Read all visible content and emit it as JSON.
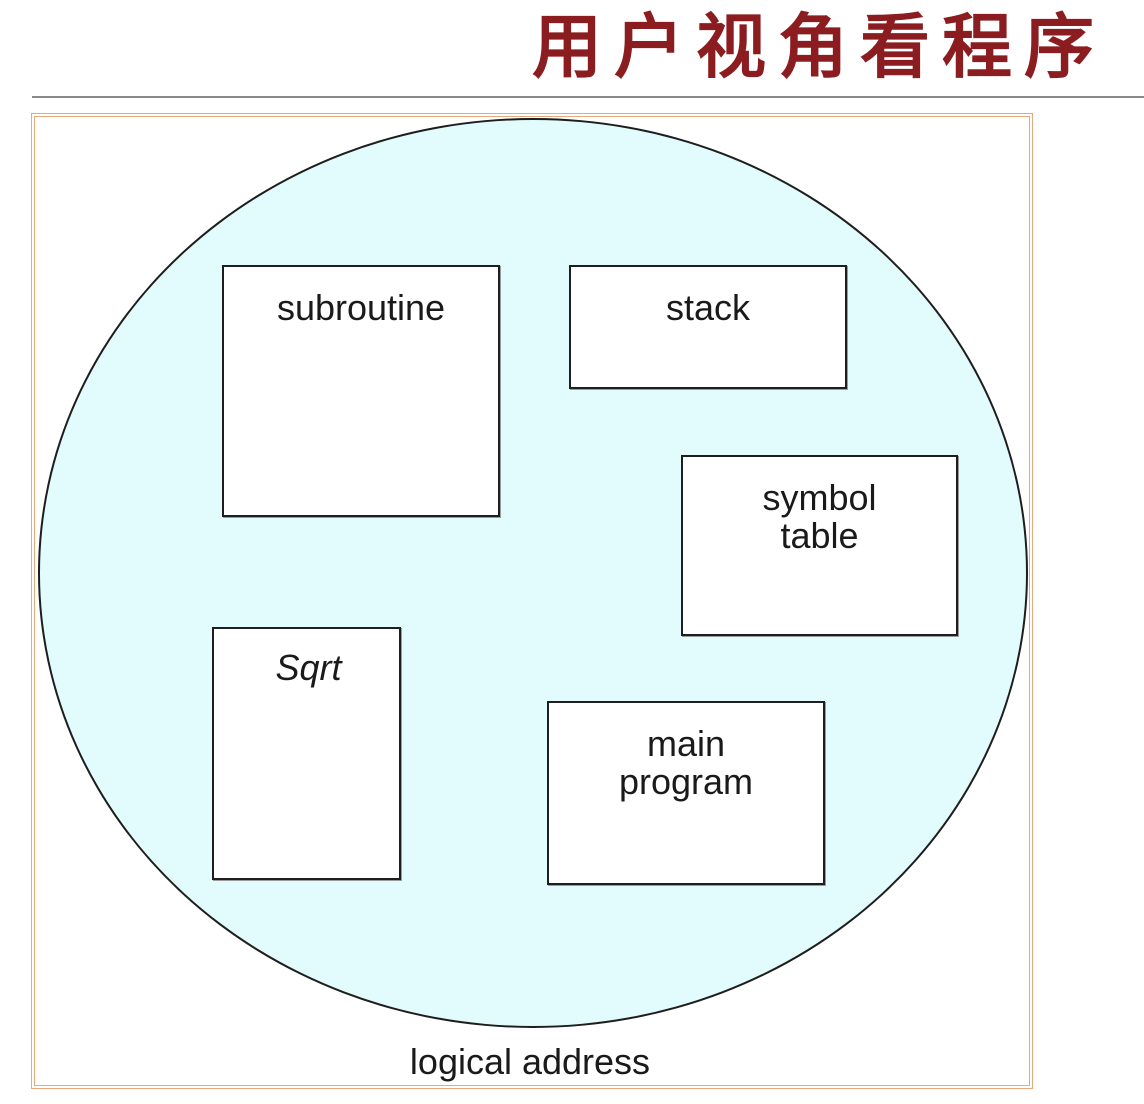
{
  "title": "用户视角看程序",
  "diagram": {
    "segments": {
      "subroutine": "subroutine",
      "stack": "stack",
      "symbol_table": "symbol\ntable",
      "sqrt": "Sqrt",
      "main_program": "main\nprogram"
    },
    "caption": "logical address"
  },
  "colors": {
    "title": "#8b1c1f",
    "frame_border": "#e8a879",
    "address_space_fill": "#e2fbfc",
    "segment_fill": "#ffffff",
    "outline": "#1e1e1e"
  }
}
